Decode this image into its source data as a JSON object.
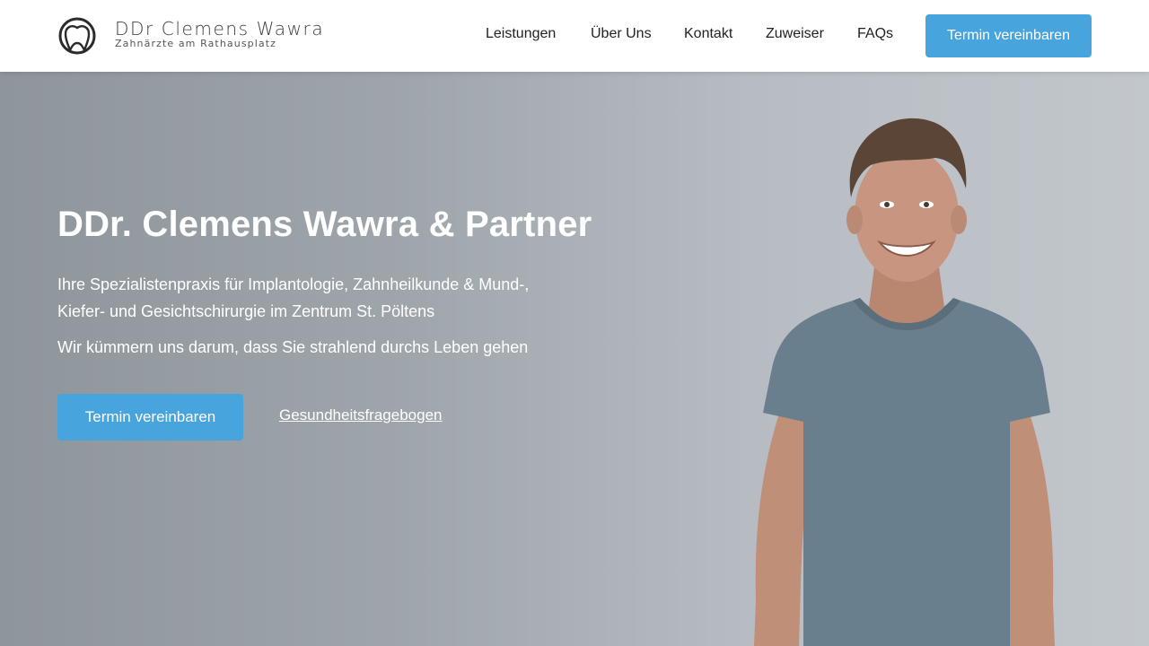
{
  "header": {
    "logo": {
      "name": "DDr Clemens Wawra",
      "tagline": "Zahnärzte am Rathausplatz",
      "icon": "tooth-logo-icon"
    },
    "nav": [
      {
        "label": "Leistungen"
      },
      {
        "label": "Über Uns"
      },
      {
        "label": "Kontakt"
      },
      {
        "label": "Zuweiser"
      },
      {
        "label": "FAQs"
      }
    ],
    "cta_label": "Termin vereinbaren"
  },
  "hero": {
    "title": "DDr. Clemens Wawra & Partner",
    "subtitle": "Ihre Spezialistenpraxis für Implantologie, Zahnheilkunde & Mund-, Kiefer- und Gesichtschirurgie im Zentrum St. Pöltens",
    "tagline": "Wir kümmern uns darum, dass Sie strahlend durchs Leben gehen",
    "cta_label": "Termin vereinbaren",
    "link_label": "Gesundheitsfragebogen",
    "image": "smiling-man-photo"
  },
  "colors": {
    "accent": "#48a4dc",
    "hero_bg": "#a3aab0",
    "header_bg": "#ffffff",
    "text_dark": "#222222"
  }
}
